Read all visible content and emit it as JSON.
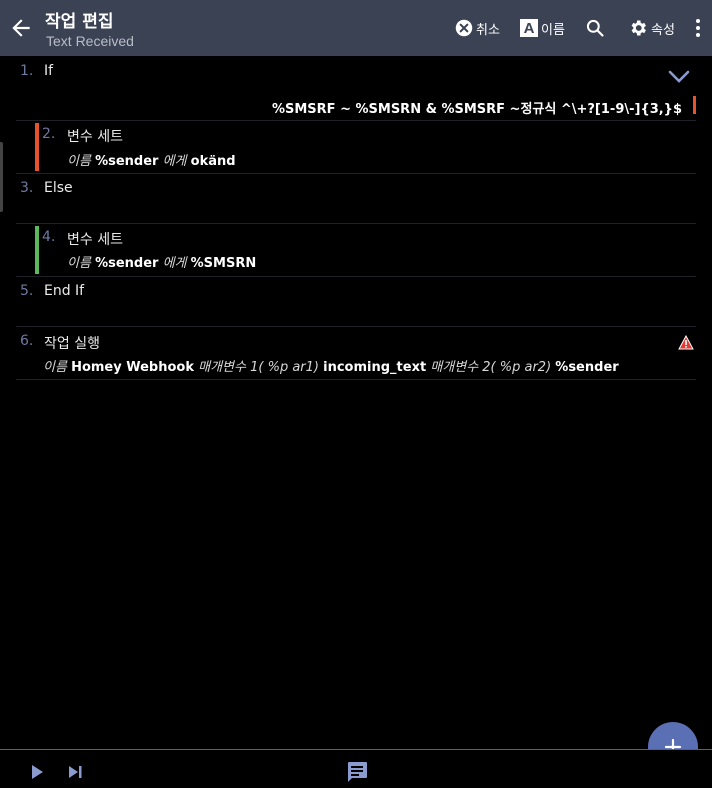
{
  "header": {
    "title": "작업 편집",
    "subtitle": "Text Received",
    "cancel_label": "취소",
    "name_label": "이름",
    "properties_label": "속성",
    "name_icon_letter": "A"
  },
  "actions": [
    {
      "num": "1.",
      "label": "If",
      "condition": "%SMSRF ~ %SMSRN & %SMSRF ~정규식 ^\\+?[1-9\\-]{3,}$"
    },
    {
      "num": "2.",
      "label": "변수 세트",
      "d1": "이름",
      "d2": "%sender",
      "d3": "에게",
      "d4": "okänd"
    },
    {
      "num": "3.",
      "label": "Else"
    },
    {
      "num": "4.",
      "label": "변수 세트",
      "d1": "이름",
      "d2": "%sender",
      "d3": "에게",
      "d4": "%SMSRN"
    },
    {
      "num": "5.",
      "label": "End If"
    },
    {
      "num": "6.",
      "label": "작업 실행",
      "d1": "이름",
      "d2": "Homey Webhook",
      "d3": "매개변수 1( %p ar1)",
      "d4": "incoming_text",
      "d5": "매개변수 2( %p ar2)",
      "d6": "%sender"
    }
  ],
  "colors": {
    "appbar": "#3b4253",
    "if_bar": "#e8532f",
    "else_bar": "#5cb85c",
    "number": "#6f7aa3",
    "fab": "#5a6fb4",
    "warning": "#e53935"
  }
}
